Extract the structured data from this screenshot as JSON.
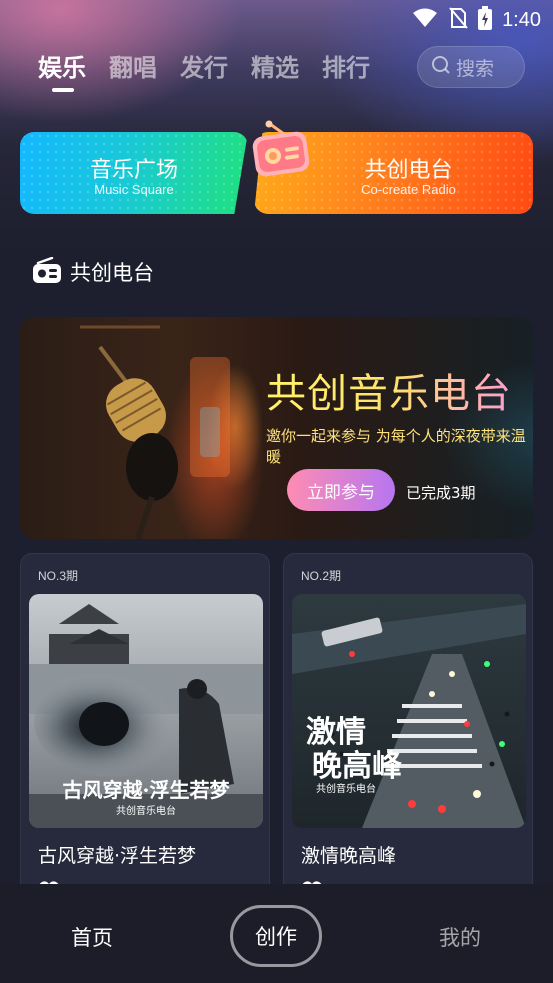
{
  "status_bar": {
    "time": "1:40"
  },
  "tabs": [
    {
      "label": "娱乐",
      "active": true
    },
    {
      "label": "翻唱",
      "active": false
    },
    {
      "label": "发行",
      "active": false
    },
    {
      "label": "精选",
      "active": false
    },
    {
      "label": "排行",
      "active": false
    }
  ],
  "search": {
    "placeholder": "搜索"
  },
  "features": {
    "music_square": {
      "title": "音乐广场",
      "subtitle": "Music Square"
    },
    "cocreate_radio": {
      "title": "共创电台",
      "subtitle": "Co-create Radio"
    }
  },
  "section": {
    "title": "共创电台"
  },
  "banner": {
    "title": "共创音乐电台",
    "subtitle": "邀你一起来参与 为每个人的深夜带来温暖",
    "join_label": "立即参与",
    "completed_text": "已完成3期"
  },
  "episodes": [
    {
      "no": "NO.3期",
      "title": "古风穿越·浮生若梦",
      "cover_text": "古风穿越·浮生若梦",
      "cover_sub": "共创音乐电台"
    },
    {
      "no": "NO.2期",
      "title": "激情晚高峰",
      "cover_text_1": "激情",
      "cover_text_2": "晚高峰",
      "cover_sub": "共创音乐电台"
    }
  ],
  "bottom_nav": {
    "home": "首页",
    "create": "创作",
    "mine": "我的"
  },
  "colors": {
    "background": "#1d1f2e",
    "music_square_gradient": [
      "#13b8ff",
      "#1fe27c"
    ],
    "radio_gradient": [
      "#ffab1a",
      "#ff4a13"
    ],
    "join_button_gradient": [
      "#ff8cb2",
      "#b676f0"
    ]
  }
}
